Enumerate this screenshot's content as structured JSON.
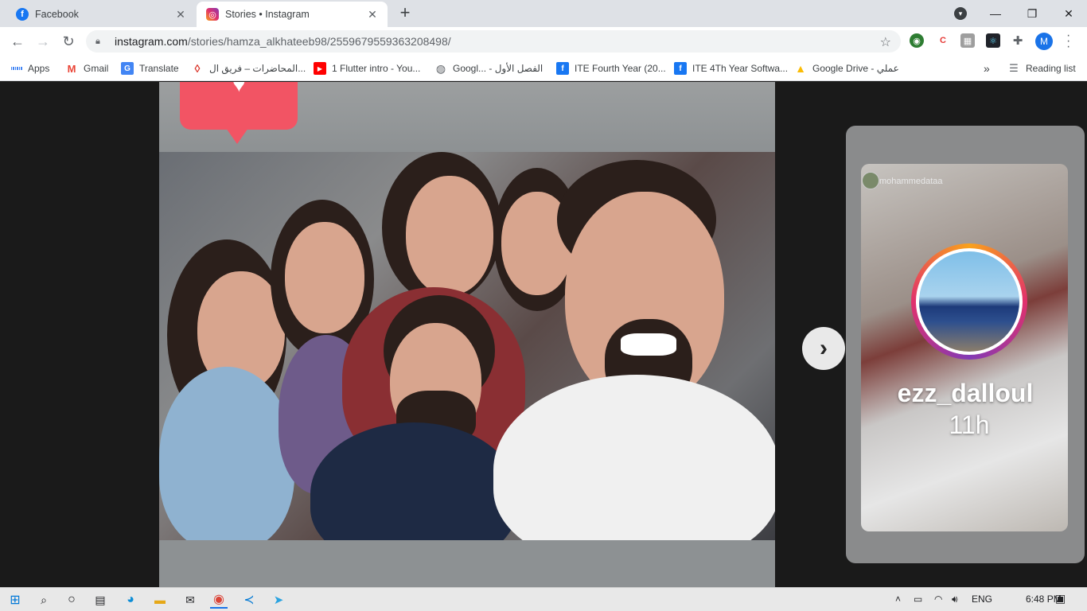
{
  "tabs": [
    {
      "title": "Facebook",
      "icon": "facebook-icon"
    },
    {
      "title": "Stories • Instagram",
      "icon": "instagram-icon"
    }
  ],
  "window_controls": {
    "minimize": "—",
    "restore": "❐",
    "close": "✕"
  },
  "toolbar": {
    "url_host": "instagram.com",
    "url_path": "/stories/hamza_alkhateeb98/2559679559363208498/",
    "profile_initial": "M"
  },
  "bookmarks": [
    {
      "label": "Apps",
      "icon": "apps-grid-icon"
    },
    {
      "label": "Gmail",
      "icon": "gmail-icon"
    },
    {
      "label": "Translate",
      "icon": "translate-icon"
    },
    {
      "label": "المحاضرات – فريق ال...",
      "icon": "drop-icon"
    },
    {
      "label": "1 Flutter intro - You...",
      "icon": "youtube-icon"
    },
    {
      "label": "Googl... - الفصل الأول",
      "icon": "globe-icon"
    },
    {
      "label": "ITE Fourth Year (20...",
      "icon": "facebook-icon"
    },
    {
      "label": "ITE 4Th Year Softwa...",
      "icon": "facebook-icon"
    },
    {
      "label": "Google Drive - عملي",
      "icon": "google-drive-icon"
    },
    {
      "label": "»",
      "icon": "overflow-icon"
    },
    {
      "label": "Reading list",
      "icon": "reading-list-icon"
    }
  ],
  "story": {
    "next_story": {
      "small_username": "mohammedataa",
      "username": "ezz_dalloul",
      "time": "11h"
    }
  },
  "taskbar": {
    "language": "ENG",
    "time": "6:48 PM"
  },
  "colors": {
    "chrome_tabstrip": "#dee1e6",
    "instagram_like": "#f25464",
    "profile_blue": "#1a73e8"
  }
}
